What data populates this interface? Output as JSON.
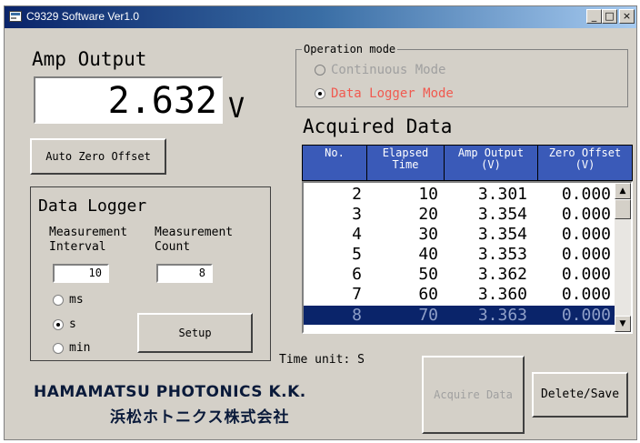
{
  "window": {
    "title": "C9329 Software Ver1.0",
    "controls": {
      "minimize": "_",
      "maximize": "□",
      "close": "×"
    }
  },
  "amp_output": {
    "title": "Amp Output",
    "value": "2.632",
    "unit": "V"
  },
  "auto_zero_button": "Auto Zero Offset",
  "operation_mode": {
    "legend": "Operation mode",
    "options": [
      {
        "label": "Continuous Mode",
        "selected": false,
        "color": "#a0a0a0"
      },
      {
        "label": "Data Logger Mode",
        "selected": true,
        "color": "#f05a50"
      }
    ]
  },
  "acquired_data": {
    "title": "Acquired Data",
    "columns": [
      "No.",
      "Elapsed\nTime",
      "Amp Output\n(V)",
      "Zero Offset\n(V)"
    ],
    "rows": [
      {
        "no": "2",
        "time": "10",
        "amp": "3.301",
        "zero": "0.000",
        "selected": false
      },
      {
        "no": "3",
        "time": "20",
        "amp": "3.354",
        "zero": "0.000",
        "selected": false
      },
      {
        "no": "4",
        "time": "30",
        "amp": "3.354",
        "zero": "0.000",
        "selected": false
      },
      {
        "no": "5",
        "time": "40",
        "amp": "3.353",
        "zero": "0.000",
        "selected": false
      },
      {
        "no": "6",
        "time": "50",
        "amp": "3.362",
        "zero": "0.000",
        "selected": false
      },
      {
        "no": "7",
        "time": "60",
        "amp": "3.360",
        "zero": "0.000",
        "selected": false
      },
      {
        "no": "8",
        "time": "70",
        "amp": "3.363",
        "zero": "0.000",
        "selected": true
      }
    ],
    "selection_color": "#0a246a",
    "header_color": "#3a5ab8"
  },
  "data_logger": {
    "title": "Data Logger",
    "interval_label_1": "Measurement",
    "interval_label_2": "Interval",
    "count_label_1": "Measurement",
    "count_label_2": "Count",
    "interval_value": "10",
    "count_value": "8",
    "units": [
      {
        "label": "ms",
        "selected": false
      },
      {
        "label": "s",
        "selected": true
      },
      {
        "label": "min",
        "selected": false
      }
    ],
    "setup_button": "Setup"
  },
  "time_unit": "Time unit: S",
  "buttons": {
    "acquire": "Acquire Data",
    "delete_save": "Delete/Save"
  },
  "branding": {
    "company_en": "HAMAMATSU PHOTONICS K.K.",
    "company_jp": "浜松ホトニクス株式会社"
  }
}
